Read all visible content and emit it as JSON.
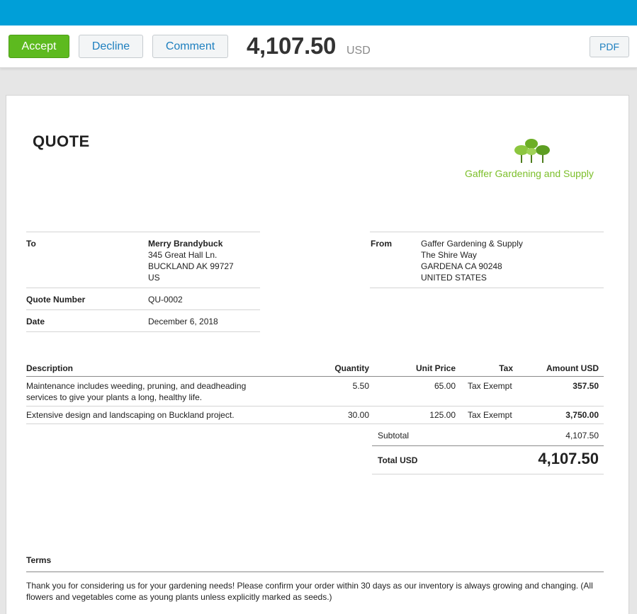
{
  "toolbar": {
    "accept_label": "Accept",
    "decline_label": "Decline",
    "comment_label": "Comment",
    "total": "4,107.50",
    "currency": "USD",
    "pdf_label": "PDF"
  },
  "colors": {
    "header_bar": "#009fd8",
    "accept_button": "#5dba1f",
    "link_blue": "#1d7fbf",
    "logo_green": "#7cbf2a"
  },
  "quote": {
    "title": "QUOTE",
    "logo_name": "Gaffer Gardening and Supply",
    "to_label": "To",
    "to_name": "Merry Brandybuck",
    "to_address": [
      "345 Great Hall Ln.",
      "BUCKLAND AK 99727",
      "US"
    ],
    "quote_number_label": "Quote Number",
    "quote_number": "QU-0002",
    "date_label": "Date",
    "date": "December 6, 2018",
    "from_label": "From",
    "from_lines": [
      "Gaffer Gardening & Supply",
      "The Shire Way",
      "GARDENA CA 90248",
      "UNITED STATES"
    ]
  },
  "table": {
    "headers": {
      "description": "Description",
      "quantity": "Quantity",
      "unit_price": "Unit Price",
      "tax": "Tax",
      "amount": "Amount USD"
    },
    "rows": [
      {
        "description_lines": [
          "Maintenance includes weeding, pruning, and deadheading",
          "services to give your plants a long, healthy life."
        ],
        "quantity": "5.50",
        "unit_price": "65.00",
        "tax": "Tax Exempt",
        "amount": "357.50"
      },
      {
        "description_lines": [
          "Extensive design and landscaping on Buckland project."
        ],
        "quantity": "30.00",
        "unit_price": "125.00",
        "tax": "Tax Exempt",
        "amount": "3,750.00"
      }
    ],
    "subtotal_label": "Subtotal",
    "subtotal": "4,107.50",
    "total_label": "Total USD",
    "total": "4,107.50"
  },
  "terms": {
    "heading": "Terms",
    "lines": [
      "Thank you for considering us for your gardening needs! Please confirm your order within 30 days as our inventory is always growing and changing. (All",
      "flowers and vegetables come as young plants unless explicitly marked as seeds.)"
    ]
  }
}
